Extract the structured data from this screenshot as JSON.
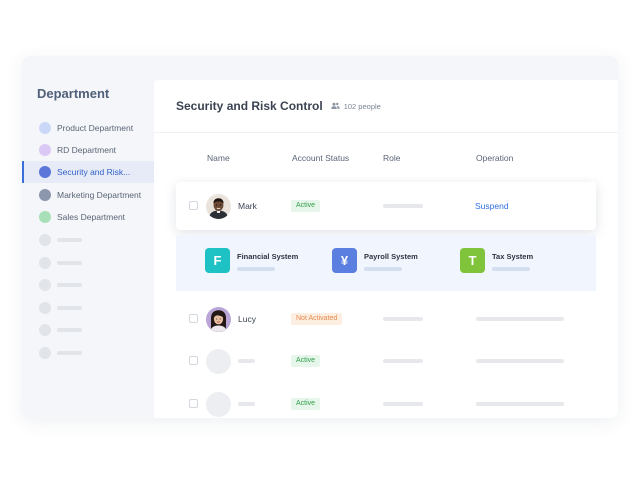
{
  "sidebar": {
    "title": "Department",
    "items": [
      {
        "label": "Product Department",
        "color": "#c9d8f7"
      },
      {
        "label": "RD Department",
        "color": "#dcc8f5"
      },
      {
        "label": "Security and Risk...",
        "color": "#5b76d8",
        "active": true
      },
      {
        "label": "Marketing Department",
        "color": "#8c96ad"
      },
      {
        "label": "Sales Department",
        "color": "#a7dfb9"
      }
    ]
  },
  "header": {
    "title": "Security and Risk Control",
    "people_count": "102 people"
  },
  "table": {
    "columns": [
      "Name",
      "Account Status",
      "Role",
      "Operation"
    ],
    "rows": [
      {
        "name": "Mark",
        "status": "Active",
        "operation": "Suspend"
      },
      {
        "name": "Lucy",
        "status": "Not Activated"
      },
      {
        "name": "",
        "status": "Active"
      },
      {
        "name": "",
        "status": "Active"
      }
    ]
  },
  "systems": [
    {
      "letter": "F",
      "name": "Financial System",
      "color": "#1ec2c4"
    },
    {
      "letter": "¥",
      "name": "Payroll System",
      "color": "#5b7fe0"
    },
    {
      "letter": "T",
      "name": "Tax System",
      "color": "#7fc43a"
    }
  ],
  "colors": {
    "accent": "#2f6ee0",
    "status_active": "#2e9d49",
    "status_pending": "#e8894b"
  }
}
